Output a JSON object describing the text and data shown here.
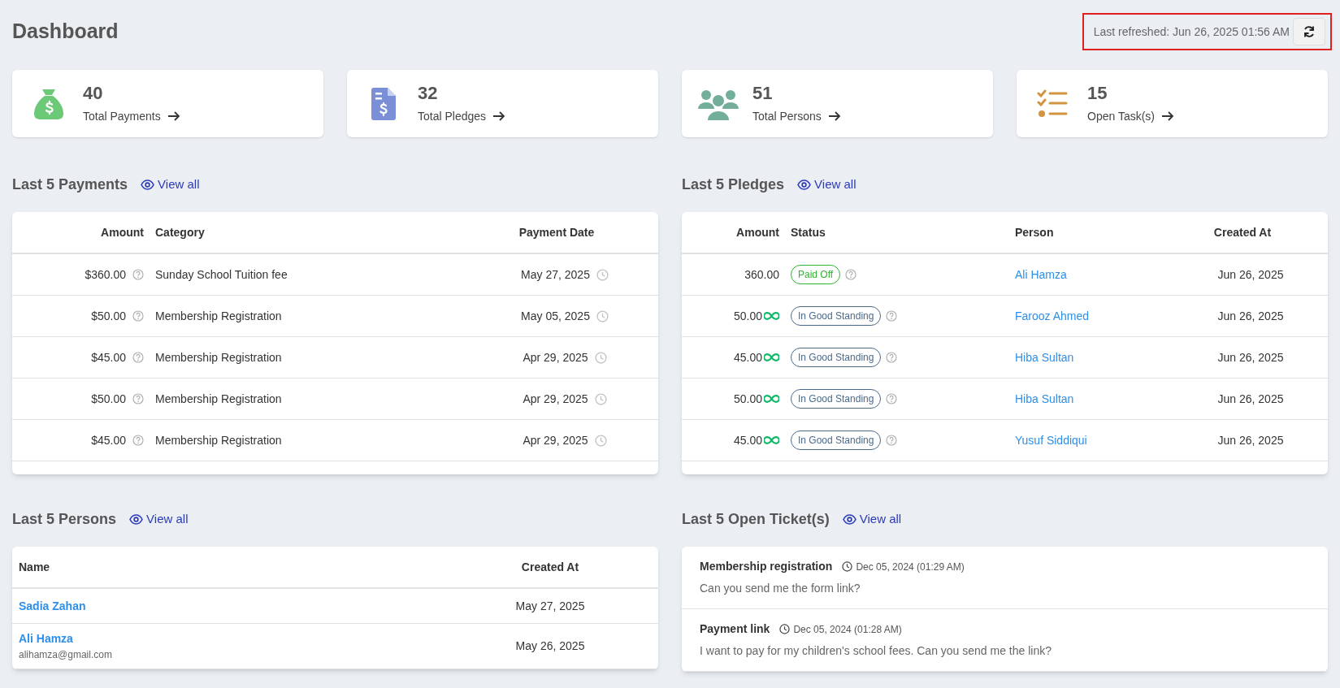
{
  "title": "Dashboard",
  "refresh": {
    "label": "Last refreshed: Jun 26, 2025 01:56 AM"
  },
  "stats": [
    {
      "kind": "payments",
      "count": "40",
      "label": "Total Payments"
    },
    {
      "kind": "pledges",
      "count": "32",
      "label": "Total Pledges"
    },
    {
      "kind": "persons",
      "count": "51",
      "label": "Total Persons"
    },
    {
      "kind": "tasks",
      "count": "15",
      "label": "Open Task(s)"
    }
  ],
  "payments": {
    "title": "Last 5 Payments",
    "view_all": "View all",
    "columns": [
      "Amount",
      "Category",
      "Payment Date"
    ],
    "rows": [
      {
        "amount": "$360.00",
        "category": "Sunday School Tuition fee",
        "date": "May 27, 2025"
      },
      {
        "amount": "$50.00",
        "category": "Membership Registration",
        "date": "May 05, 2025"
      },
      {
        "amount": "$45.00",
        "category": "Membership Registration",
        "date": "Apr 29, 2025"
      },
      {
        "amount": "$50.00",
        "category": "Membership Registration",
        "date": "Apr 29, 2025"
      },
      {
        "amount": "$45.00",
        "category": "Membership Registration",
        "date": "Apr 29, 2025"
      }
    ]
  },
  "pledges": {
    "title": "Last 5 Pledges",
    "view_all": "View all",
    "columns": [
      "Amount",
      "Status",
      "Person",
      "Created At"
    ],
    "rows": [
      {
        "amount": "360.00",
        "recurring": false,
        "status": "Paid Off",
        "color": "#2fb52f",
        "person": "Ali Hamza",
        "created": "Jun 26, 2025"
      },
      {
        "amount": "50.00",
        "recurring": true,
        "status": "In Good Standing",
        "color": "#4a6a8a",
        "person": "Farooz Ahmed",
        "created": "Jun 26, 2025"
      },
      {
        "amount": "45.00",
        "recurring": true,
        "status": "In Good Standing",
        "color": "#4a6a8a",
        "person": "Hiba Sultan",
        "created": "Jun 26, 2025"
      },
      {
        "amount": "50.00",
        "recurring": true,
        "status": "In Good Standing",
        "color": "#4a6a8a",
        "person": "Hiba Sultan",
        "created": "Jun 26, 2025"
      },
      {
        "amount": "45.00",
        "recurring": true,
        "status": "In Good Standing",
        "color": "#4a6a8a",
        "person": "Yusuf Siddiqui",
        "created": "Jun 26, 2025"
      }
    ]
  },
  "persons": {
    "title": "Last 5 Persons",
    "view_all": "View all",
    "columns": [
      "Name",
      "Created At"
    ],
    "rows": [
      {
        "name": "Sadia Zahan",
        "created": "May 27, 2025"
      },
      {
        "name": "Ali Hamza",
        "email": "alihamza@gmail.com",
        "created": "May 26, 2025"
      }
    ]
  },
  "tickets": {
    "title": "Last 5 Open Ticket(s)",
    "view_all": "View all",
    "items": [
      {
        "subject": "Membership registration",
        "time": "Dec 05, 2024 (01:29 AM)",
        "message": "Can you send me the form link?"
      },
      {
        "subject": "Payment link",
        "time": "Dec 05, 2024 (01:28 AM)",
        "message": "I want to pay for my children's school fees. Can you send me the link?"
      }
    ]
  }
}
